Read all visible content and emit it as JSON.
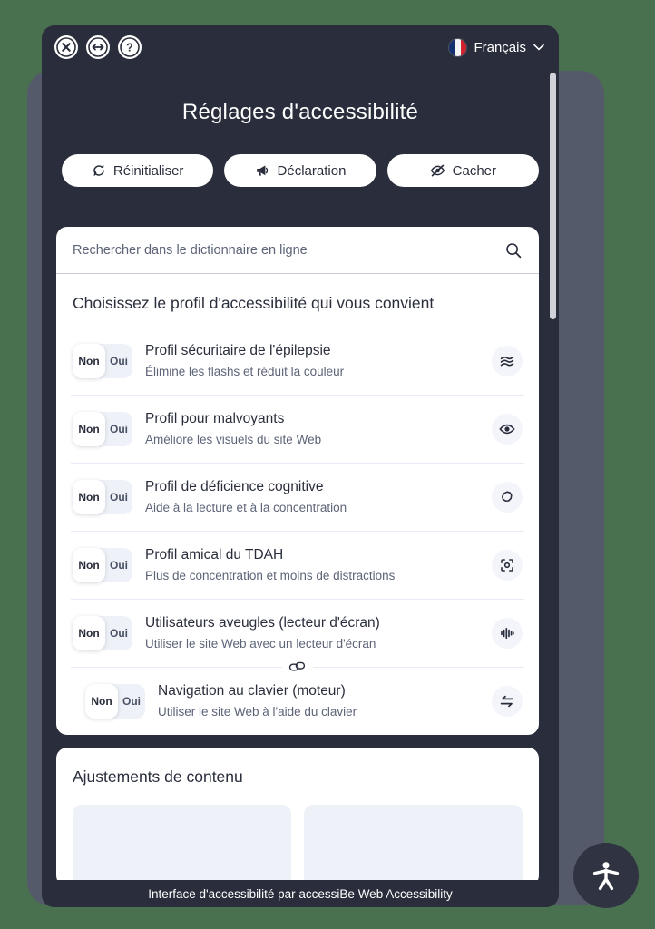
{
  "window": {
    "background_color": "#49704f",
    "frame_color": "#555a6a",
    "panel_color": "#2a2e3c"
  },
  "topbar": {
    "close_label": "close-icon",
    "resize_label": "resize-icon",
    "help_label": "help-icon",
    "language": "Français",
    "language_chevron": "chevron-down-icon",
    "flag": "france-flag"
  },
  "header": {
    "title": "Réglages d'accessibilité"
  },
  "actions": [
    {
      "label": "Réinitialiser",
      "icon": "reset-icon"
    },
    {
      "label": "Déclaration",
      "icon": "megaphone-icon"
    },
    {
      "label": "Cacher",
      "icon": "eye-slash-icon"
    }
  ],
  "search": {
    "placeholder": "Rechercher dans le dictionnaire en ligne",
    "value": "",
    "icon": "search-icon"
  },
  "profiles_section": {
    "heading": "Choisissez le profil d'accessibilité qui vous convient",
    "toggle": {
      "off_label": "Non",
      "on_label": "Oui",
      "selected": "Non"
    },
    "rows": [
      {
        "title": "Profil sécuritaire de l'épilepsie",
        "desc": "Élimine les flashs et réduit la couleur",
        "icon": "waves-icon",
        "state": "Non"
      },
      {
        "title": "Profil pour malvoyants",
        "desc": "Améliore les visuels du site Web",
        "icon": "eye-icon",
        "state": "Non"
      },
      {
        "title": "Profil de déficience cognitive",
        "desc": "Aide à la lecture et à la concentration",
        "icon": "puzzle-icon",
        "state": "Non"
      },
      {
        "title": "Profil amical du TDAH",
        "desc": "Plus de concentration et moins de distractions",
        "icon": "focus-target-icon",
        "state": "Non"
      },
      {
        "title": "Utilisateurs aveugles (lecteur d'écran)",
        "desc": "Utiliser le site Web avec un lecteur d'écran",
        "icon": "audio-waveform-icon",
        "state": "Non"
      },
      {
        "title": "Navigation au clavier (moteur)",
        "desc": "Utiliser le site Web à l'aide du clavier",
        "icon": "swap-arrows-icon",
        "state": "Non",
        "divider_icon": "link-chain-icon"
      }
    ]
  },
  "content_section": {
    "heading": "Ajustements de contenu"
  },
  "footer": {
    "text": "Interface d'accessibilité par accessiBe Web Accessibility"
  },
  "fab": {
    "icon": "accessibility-person-icon"
  }
}
